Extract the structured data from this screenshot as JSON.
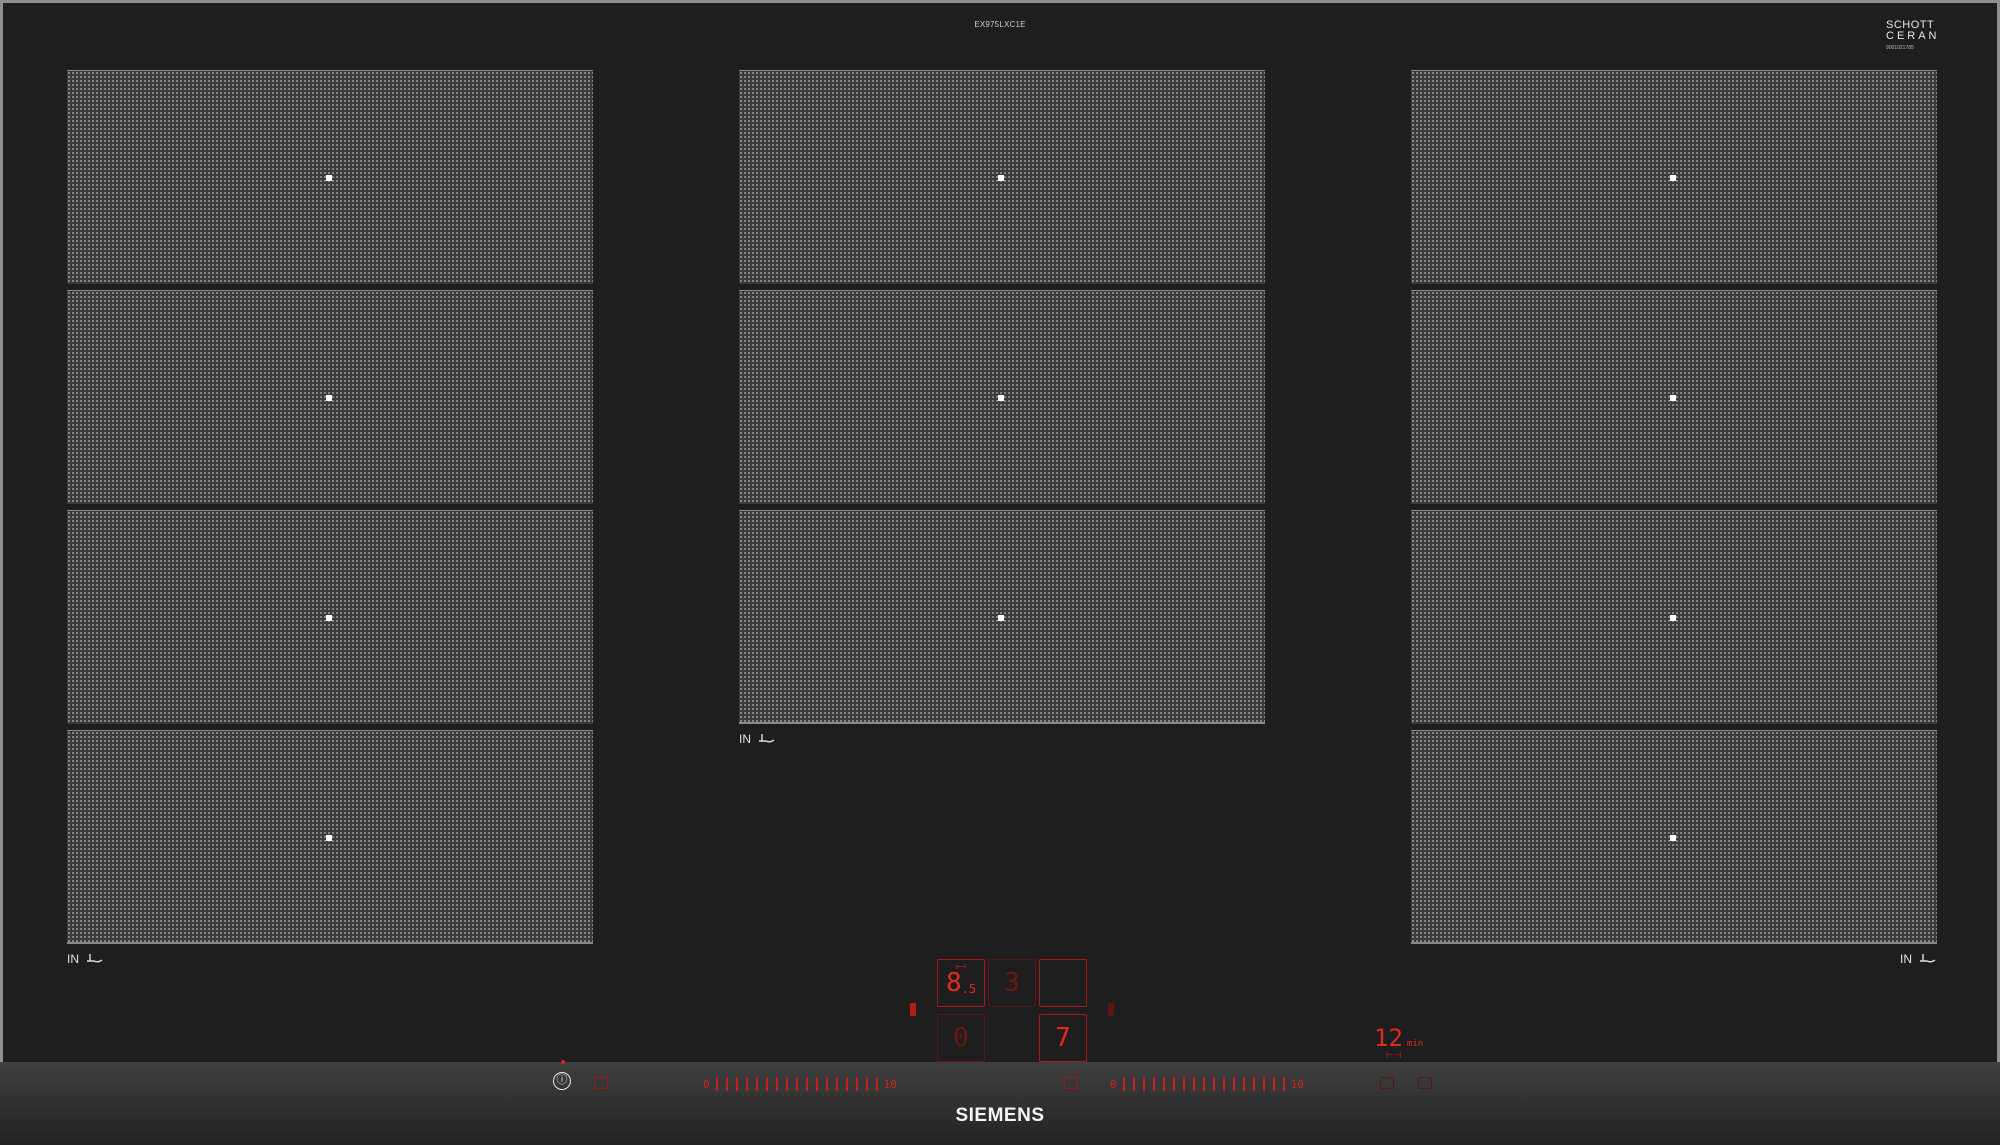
{
  "hob": {
    "model_number": "EX975LXC1E",
    "brand_line1": "SCHOTT",
    "brand_line2": "CERAN",
    "brand_serial": "9001021785",
    "manufacturer": "SIEMENS"
  },
  "zones": {
    "left": {
      "count": 4,
      "label": "IN"
    },
    "center": {
      "count": 3,
      "label": "IN"
    },
    "right": {
      "count": 4,
      "label": "IN"
    }
  },
  "controls": {
    "power_symbol": "ⓘ",
    "slider_left": {
      "min": "0",
      "max": "10"
    },
    "slider_right": {
      "min": "0",
      "max": "10"
    },
    "displays": {
      "top_left": "8",
      "top_left_decimal": ".5",
      "top_middle": "3",
      "top_right": "",
      "bottom_left": "0",
      "bottom_right": "7"
    },
    "timer_value": "12",
    "timer_unit": "min"
  },
  "colors": {
    "glass": "#1f1e1e",
    "zone_grid": "#3b3b3b",
    "led_red": "#e2291f",
    "frame": "#8e8e8e"
  }
}
